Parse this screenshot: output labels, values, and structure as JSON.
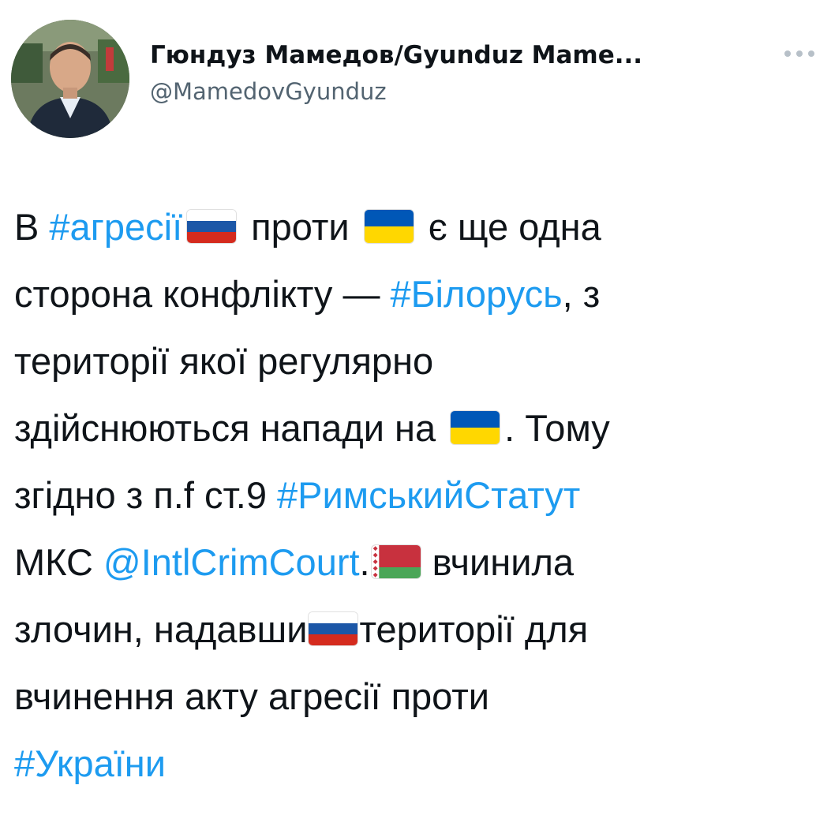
{
  "author": {
    "display_name": "Гюндуз Мамедов/Gyunduz Mame...",
    "handle": "@MamedovGyunduz",
    "avatar_icon": "profile-photo"
  },
  "header": {
    "more_icon": "more-options-icon"
  },
  "colors": {
    "link": "#1d9bf0",
    "text": "#0f1419",
    "secondary": "#536471"
  },
  "flags": {
    "russia": [
      "#ffffff",
      "#1c57a7",
      "#d52b1e"
    ],
    "ukraine": [
      "#0057b7",
      "#ffd700"
    ],
    "belarus": [
      "#c8313e",
      "#4aa657"
    ]
  },
  "tweet": {
    "l1_a": "В ",
    "l1_tag": "#агресії",
    "l1_b": " проти ",
    "l1_c": " є ще одна",
    "l2_a": "сторона конфлікту — ",
    "l2_tag": "#Білорусь",
    "l2_b": ", з",
    "l3": "території якої регулярно",
    "l4_a": "здійснюються напади на ",
    "l4_b": ". Тому",
    "l5_a": "згідно з п.f ст.9 ",
    "l5_tag": "#РимськийСтатут",
    "l6_a": "МКС ",
    "l6_mention": "@IntlCrimCourt",
    "l6_b": ".",
    "l6_c": " вчинила",
    "l7_a": "злочин, надавши",
    "l7_b": "території для",
    "l8": "вчинення акту агресії проти",
    "l9_tag": "#України"
  }
}
